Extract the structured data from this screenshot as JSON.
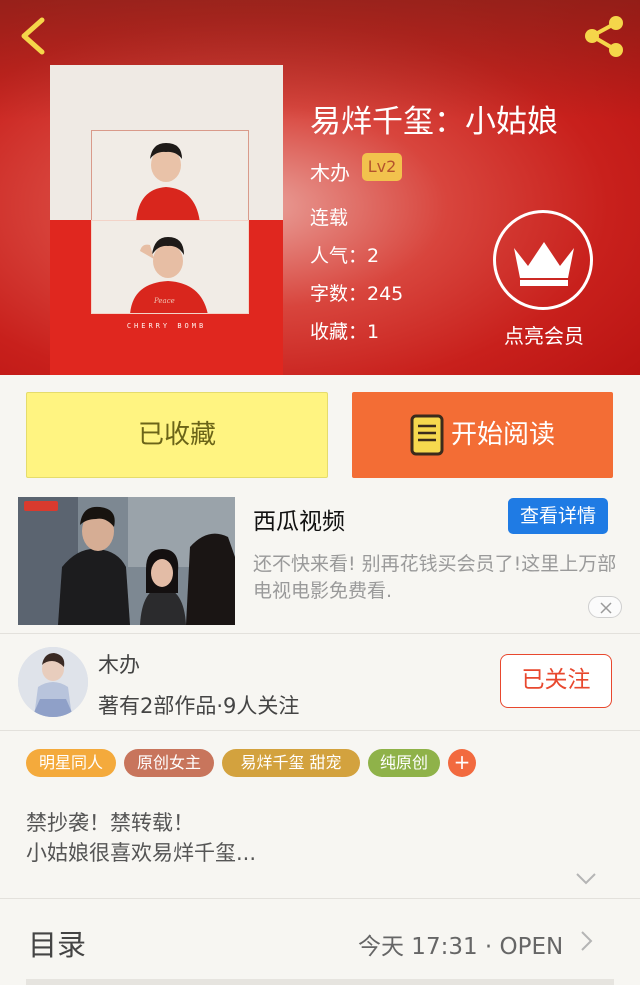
{
  "colors": {
    "header_red": "#c8201c",
    "favorited_yellow": "#fff481",
    "read_orange": "#f36d35",
    "follow_red": "#e8482e",
    "details_blue": "#1f7be4",
    "level_gold": "#f2c24d"
  },
  "header": {
    "icons": {
      "back": "back-chevron-icon",
      "share": "share-icon"
    }
  },
  "book": {
    "title": "易烊千玺：小姑娘",
    "cover_text": "CHERRY BOMB",
    "author": "木办",
    "level": "Lv2",
    "status": "连载",
    "popularity": "人气：2",
    "word_count": "字数：245",
    "favorites": "收藏：1"
  },
  "vip": {
    "label": "点亮会员",
    "icon": "crown-icon"
  },
  "actions": {
    "favorited_label": "已收藏",
    "read_label": "开始阅读",
    "read_icon": "book-icon"
  },
  "ad": {
    "brand": "西瓜视频",
    "details_label": "查看详情",
    "description": "还不快来看! 别再花钱买会员了!这里上万部电视电影免费看.",
    "close_icon": "close-icon"
  },
  "author_row": {
    "name": "木办",
    "stats": "著有2部作品·9人关注",
    "follow_label": "已关注"
  },
  "tags": {
    "items": [
      {
        "label": "明星同人",
        "color": "#f4aa3c"
      },
      {
        "label": "原创女主",
        "color": "#c8755c"
      },
      {
        "label": "易烊千玺 甜宠",
        "color": "#d3a23e"
      },
      {
        "label": "纯原创",
        "color": "#8fb249"
      }
    ],
    "add_label": "+"
  },
  "description": {
    "line1": "禁抄袭！禁转载！",
    "line2": "小姑娘很喜欢易烊千玺..."
  },
  "catalog": {
    "title": "目录",
    "update": "今天 17:31 · OPEN"
  }
}
